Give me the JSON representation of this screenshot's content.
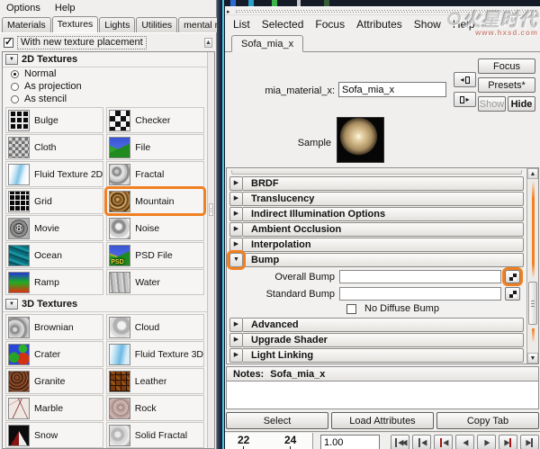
{
  "left_panel": {
    "menubar": [
      "Options",
      "Help"
    ],
    "tabs": [
      "Materials",
      "Textures",
      "Lights",
      "Utilities",
      "mental ray"
    ],
    "active_tab": "Textures",
    "placement_label": "With new texture placement",
    "placement_checked": true,
    "highlighted_item": "Mountain",
    "sections": [
      {
        "title": "2D Textures",
        "radios": [
          "Normal",
          "As projection",
          "As stencil"
        ],
        "selected_radio": "Normal",
        "items": [
          {
            "label": "Bulge",
            "swatch": "bulge"
          },
          {
            "label": "Checker",
            "swatch": "checker"
          },
          {
            "label": "Cloth",
            "swatch": "cloth"
          },
          {
            "label": "File",
            "swatch": "file"
          },
          {
            "label": "Fluid Texture 2D",
            "swatch": "fluid2d"
          },
          {
            "label": "Fractal",
            "swatch": "fractal"
          },
          {
            "label": "Grid",
            "swatch": "grid"
          },
          {
            "label": "Mountain",
            "swatch": "mountain"
          },
          {
            "label": "Movie",
            "swatch": "movie",
            "overlay": "8",
            "overlay_class": "movie"
          },
          {
            "label": "Noise",
            "swatch": "noise"
          },
          {
            "label": "Ocean",
            "swatch": "ocean"
          },
          {
            "label": "PSD File",
            "swatch": "psd",
            "overlay": "PSD",
            "overlay_class": "psd"
          },
          {
            "label": "Ramp",
            "swatch": "ramp"
          },
          {
            "label": "Water",
            "swatch": "water"
          }
        ]
      },
      {
        "title": "3D Textures",
        "items": [
          {
            "label": "Brownian",
            "swatch": "brownian"
          },
          {
            "label": "Cloud",
            "swatch": "cloud"
          },
          {
            "label": "Crater",
            "swatch": "crater"
          },
          {
            "label": "Fluid Texture 3D",
            "swatch": "fluid3d"
          },
          {
            "label": "Granite",
            "swatch": "granite"
          },
          {
            "label": "Leather",
            "swatch": "leather"
          },
          {
            "label": "Marble",
            "swatch": "marble"
          },
          {
            "label": "Rock",
            "swatch": "rock"
          },
          {
            "label": "Snow",
            "swatch": "snow"
          },
          {
            "label": "Solid Fractal",
            "swatch": "solidfractal"
          }
        ]
      }
    ]
  },
  "right_panel": {
    "menubar": [
      "List",
      "Selected",
      "Focus",
      "Attributes",
      "Show",
      "Help"
    ],
    "logo": {
      "text": "火星时代",
      "url": "www.hxsd.com"
    },
    "tab": "Sofa_mia_x",
    "header": {
      "material_label": "mia_material_x:",
      "name_value": "Sofa_mia_x",
      "focus_label": "Focus",
      "presets_label": "Presets*",
      "show_label": "Show",
      "hide_label": "Hide",
      "sample_label": "Sample"
    },
    "attributes": {
      "sections_above_bump": [
        "BRDF",
        "Translucency",
        "Indirect Illumination Options",
        "Ambient Occlusion",
        "Interpolation"
      ],
      "bump_label": "Bump",
      "overall_bump_label": "Overall Bump",
      "standard_bump_label": "Standard Bump",
      "no_diffuse_bump_label": "No Diffuse Bump",
      "sections_below_bump": [
        "Advanced",
        "Upgrade Shader",
        "Light Linking"
      ]
    },
    "notes": {
      "label": "Notes:",
      "value": "Sofa_mia_x"
    },
    "footer": {
      "select": "Select",
      "load": "Load Attributes",
      "copy": "Copy Tab"
    },
    "timeline": {
      "tick1": "22",
      "tick2": "24",
      "speed": "1.00",
      "controls": [
        {
          "name": "go-to-start",
          "glyph": "◀◀",
          "pre": true
        },
        {
          "name": "step-back-frame",
          "glyph": "◀",
          "pre": true
        },
        {
          "name": "step-back-key",
          "glyph": "◀",
          "pre": true,
          "red": true
        },
        {
          "name": "play-backwards",
          "glyph": "◀"
        },
        {
          "name": "play-forwards",
          "glyph": "▶"
        },
        {
          "name": "step-forward-key",
          "glyph": "▶",
          "post": true,
          "red": true
        },
        {
          "name": "step-forward-frame",
          "glyph": "▶",
          "post": true
        },
        {
          "name": "go-to-end",
          "glyph": "▶▶",
          "post": true
        }
      ]
    },
    "accent_colors": {
      "annotation_orange": "#f08021",
      "divider_cyan": "#49c8e8"
    }
  }
}
